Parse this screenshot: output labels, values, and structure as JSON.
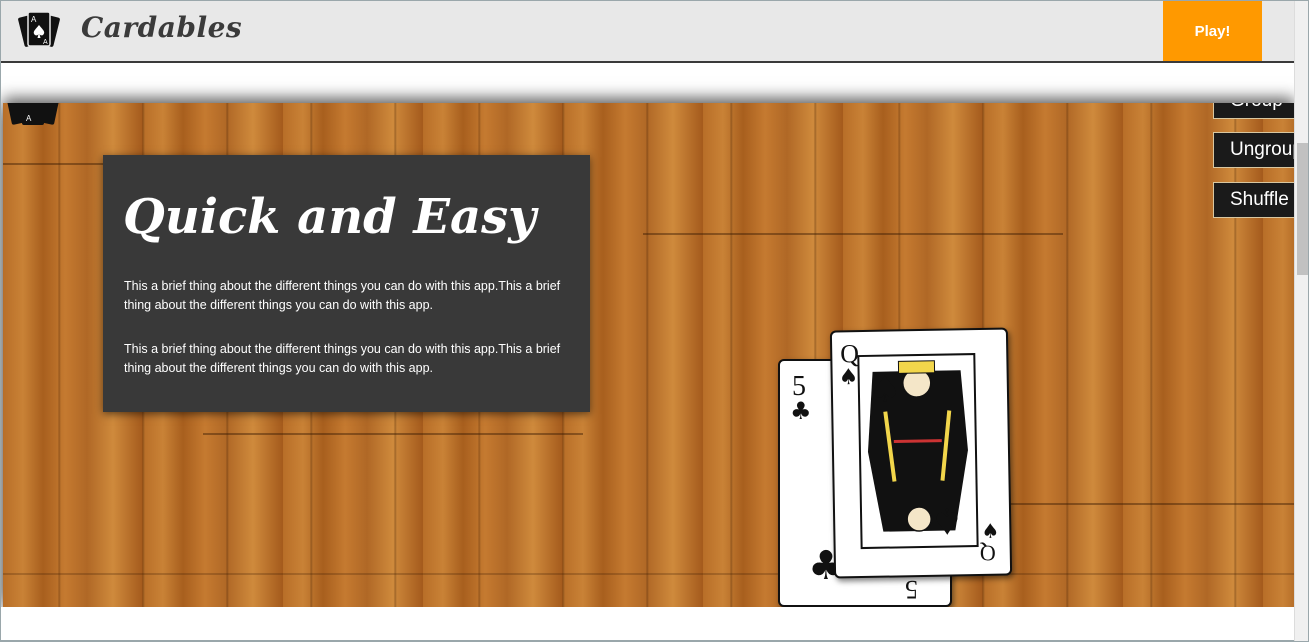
{
  "navbar": {
    "brand": "Cardables",
    "play_label": "Play!"
  },
  "info": {
    "title": "Quick and Easy",
    "paragraph1": "This a brief thing about the different things you can do with this app.This a brief thing about the different things you can do with this app.",
    "paragraph2": "This a brief thing about the different things you can do with this app.This a brief thing about the different things you can do with this app."
  },
  "controls": {
    "group_label": "Group",
    "ungroup_label": "Ungroup",
    "shuffle_label": "Shuffle"
  },
  "cards": {
    "five": {
      "rank": "5",
      "suit": "♣"
    },
    "queen": {
      "rank": "Q",
      "suit": "♠"
    }
  },
  "colors": {
    "accent": "#ff9900",
    "navbar_bg": "#e8e8e8",
    "info_bg": "#393939",
    "wood": "#b56d27"
  },
  "icons": {
    "brand": "playing-cards-icon",
    "corner": "card-stack-icon"
  }
}
